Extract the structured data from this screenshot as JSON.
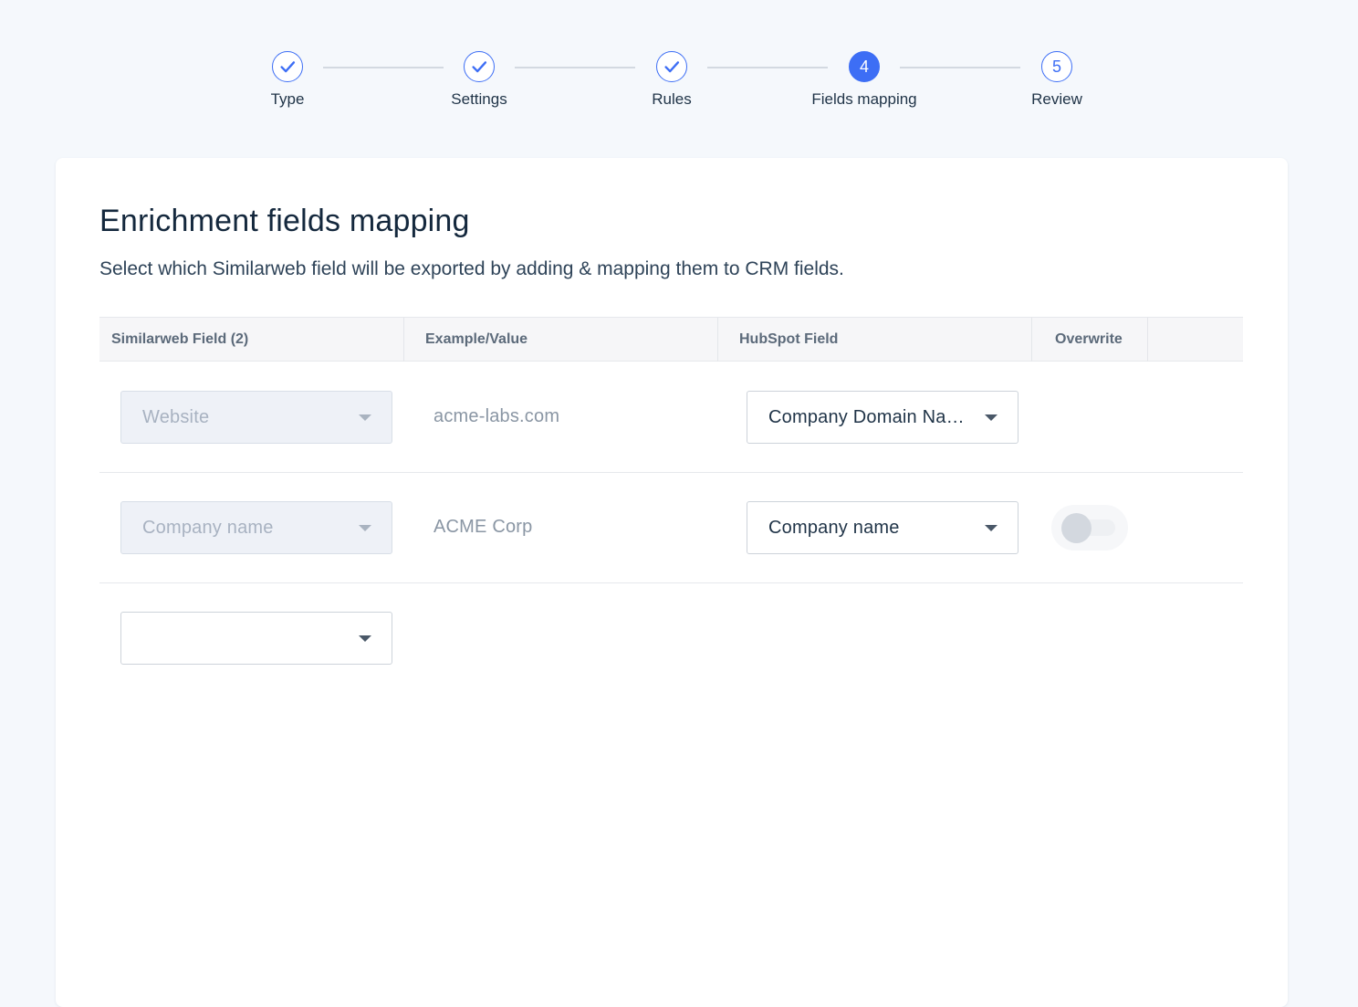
{
  "stepper": {
    "steps": [
      {
        "label": "Type",
        "status": "completed",
        "number": "1"
      },
      {
        "label": "Settings",
        "status": "completed",
        "number": "2"
      },
      {
        "label": "Rules",
        "status": "completed",
        "number": "3"
      },
      {
        "label": "Fields mapping",
        "status": "active",
        "number": "4"
      },
      {
        "label": "Review",
        "status": "upcoming",
        "number": "5"
      }
    ]
  },
  "page": {
    "title": "Enrichment fields mapping",
    "subtitle": "Select which Similarweb field will be exported by adding & mapping them to CRM fields."
  },
  "table": {
    "headers": {
      "similarweb_field": "Similarweb Field (2)",
      "example": "Example/Value",
      "hubspot_field": "HubSpot Field",
      "overwrite": "Overwrite"
    },
    "rows": [
      {
        "similarweb_field": "Website",
        "example": "acme-labs.com",
        "hubspot_field": "Company Domain Name",
        "overwrite": null
      },
      {
        "similarweb_field": "Company name",
        "example": "ACME Corp",
        "hubspot_field": "Company name",
        "overwrite": false
      }
    ],
    "new_row": {
      "similarweb_field": ""
    }
  },
  "colors": {
    "accent": "#3d6ef5",
    "page_background": "#f5f8fc",
    "card_background": "#ffffff",
    "disabled_select": "#eef1f7"
  },
  "icons": {
    "completed_step": "check-icon",
    "dropdown": "caret-down-icon"
  }
}
